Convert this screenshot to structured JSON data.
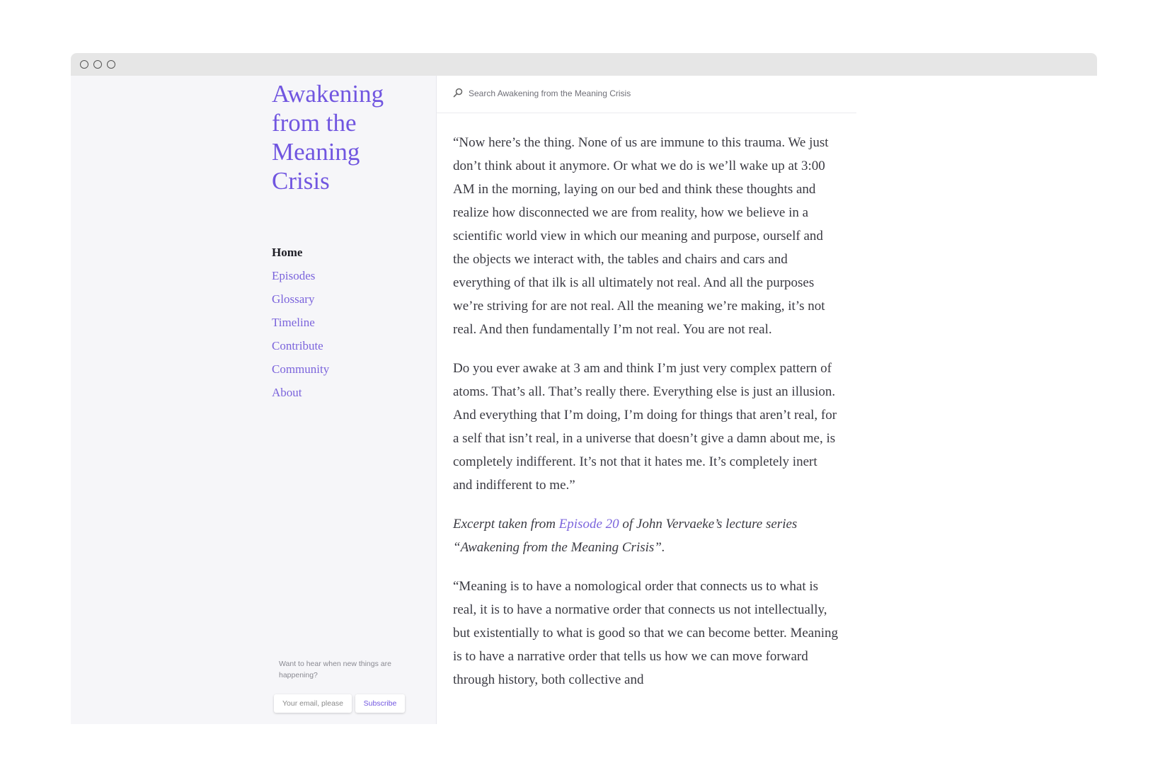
{
  "window": {
    "controls": [
      "close",
      "minimize",
      "maximize"
    ]
  },
  "sidebar": {
    "site_title": "Awakening from the Meaning Crisis",
    "nav": [
      {
        "label": "Home",
        "active": true
      },
      {
        "label": "Episodes",
        "active": false
      },
      {
        "label": "Glossary",
        "active": false
      },
      {
        "label": "Timeline",
        "active": false
      },
      {
        "label": "Contribute",
        "active": false
      },
      {
        "label": "Community",
        "active": false
      },
      {
        "label": "About",
        "active": false
      }
    ],
    "subscribe": {
      "prompt": "Want to hear when new things are happening?",
      "email_placeholder": "Your email, please",
      "button_label": "Subscribe"
    }
  },
  "search": {
    "placeholder": "Search Awakening from the Meaning Crisis",
    "icon": "search-icon"
  },
  "main": {
    "paragraphs": [
      "“Now here’s the thing. None of us are immune to this trauma. We just don’t think about it anymore. Or what we do is we’ll wake up at 3:00 AM in the morning, laying on our bed and think these thoughts and realize how disconnected we are from reality, how we believe in a scientific world view in which our meaning and purpose, ourself and the objects we interact with, the tables and chairs and cars and everything of that ilk is all ultimately not real. And all the purposes we’re striving for are not real. All the meaning we’re making, it’s not real. And then fundamentally I’m not real. You are not real.",
      "Do you ever awake at 3 am and think I’m just very complex pattern of atoms. That’s all. That’s really there. Everything else is just an illusion. And everything that I’m doing, I’m doing for things that aren’t real, for a self that isn’t real, in a universe that doesn’t give a damn about me, is completely indifferent. It’s not that it hates me. It’s completely inert and indifferent to me.”"
    ],
    "excerpt": {
      "prefix": "Excerpt taken from ",
      "link_text": "Episode 20",
      "suffix": " of John Vervaeke’s lecture series “Awakening from the Meaning Crisis”."
    },
    "quote2": "“Meaning is to have a nomological order that connects us to what is real, it is to have a normative order that connects us not intellectually, but existentially to what is good so that we can become better. Meaning is to have a narrative order that tells us how we can move forward through history, both collective and"
  },
  "colors": {
    "accent": "#7156e0",
    "nav_link": "#7b64dc",
    "body_text": "#3a3a42",
    "sidebar_bg": "#f6f6f9",
    "titlebar_bg": "#e6e6e6"
  }
}
